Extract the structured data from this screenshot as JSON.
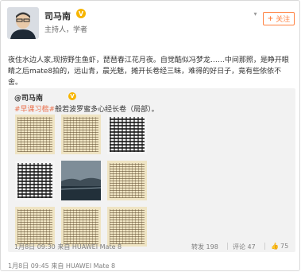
{
  "author": {
    "name": "司马南",
    "subtitle": "主持人，学者"
  },
  "follow_button": {
    "plus": "+",
    "label": "关注"
  },
  "more_icon": "chevron-down-icon",
  "post": {
    "text": "夜住水边人家,现捞野生鱼虾，琵琶春江花月夜。自觉酷似冯梦龙……中间那照，是睁开眼睛之后mate8拍的，远山青，晨光魅，摊开长卷经三昧，难得的好日子，竟有些依依不舍。"
  },
  "quoted": {
    "author": "@司马南",
    "tag": "#早课习楷#",
    "text": "般若波罗蜜多心经长卷（局部）。",
    "date": "1月8日 09:30 来自 HUAWEI Mate 8",
    "stats": {
      "share": "转发 198",
      "comment": "评论 47",
      "like": "75"
    }
  },
  "footer": {
    "date": "1月8日 09:45 来自 HUAWEI Mate 8"
  },
  "colors": {
    "accent": "#ff8140",
    "tag": "#eb7350",
    "badge": "#f7b500"
  }
}
